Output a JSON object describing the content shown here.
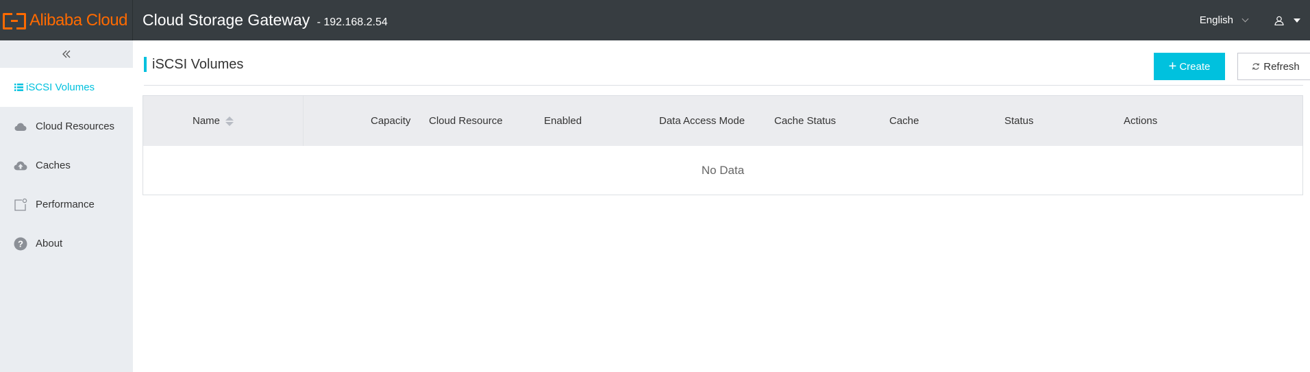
{
  "header": {
    "brand": "Alibaba Cloud",
    "title": "Cloud Storage Gateway",
    "ip": "- 192.168.2.54",
    "language": "English"
  },
  "sidebar": {
    "items": [
      {
        "label": "iSCSI Volumes",
        "icon": "list-icon",
        "active": true
      },
      {
        "label": "Cloud Resources",
        "icon": "cloud-icon",
        "active": false
      },
      {
        "label": "Caches",
        "icon": "cloud-upload-icon",
        "active": false
      },
      {
        "label": "Performance",
        "icon": "performance-icon",
        "active": false
      },
      {
        "label": "About",
        "icon": "help-circle-icon",
        "active": false
      }
    ]
  },
  "main": {
    "page_title": "iSCSI Volumes",
    "create_label": "Create",
    "refresh_label": "Refresh",
    "table": {
      "columns": [
        "Name",
        "Capacity",
        "Cloud Resource",
        "Enabled",
        "Data Access Mode",
        "Cache Status",
        "Cache",
        "Status",
        "Actions"
      ],
      "empty_text": "No Data"
    }
  },
  "colors": {
    "accent": "#00c1de",
    "brand": "#ff6a00",
    "topbar": "#373d41",
    "sidebar": "#eaedf1",
    "table_header": "#ebecef"
  }
}
